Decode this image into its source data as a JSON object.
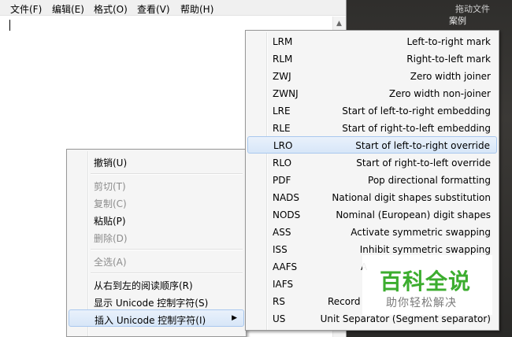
{
  "menubar": {
    "items": [
      "文件(F)",
      "编辑(E)",
      "格式(O)",
      "查看(V)",
      "帮助(H)"
    ]
  },
  "background": {
    "text1": "拖动文件",
    "text2": "案例"
  },
  "context_menu": {
    "items": [
      {
        "label": "撤销(U)",
        "enabled": true
      },
      {
        "label": "剪切(T)",
        "enabled": false
      },
      {
        "label": "复制(C)",
        "enabled": false
      },
      {
        "label": "粘贴(P)",
        "enabled": true
      },
      {
        "label": "删除(D)",
        "enabled": false
      },
      {
        "label": "全选(A)",
        "enabled": false
      },
      {
        "label": "从右到左的阅读顺序(R)",
        "enabled": true
      },
      {
        "label": "显示 Unicode 控制字符(S)",
        "enabled": true
      },
      {
        "label": "插入 Unicode 控制字符(I)",
        "enabled": true,
        "highlighted": true
      }
    ]
  },
  "submenu": {
    "items": [
      {
        "abbr": "LRM",
        "desc": "Left-to-right mark"
      },
      {
        "abbr": "RLM",
        "desc": "Right-to-left mark"
      },
      {
        "abbr": "ZWJ",
        "desc": "Zero width joiner"
      },
      {
        "abbr": "ZWNJ",
        "desc": "Zero width non-joiner"
      },
      {
        "abbr": "LRE",
        "desc": "Start of left-to-right embedding"
      },
      {
        "abbr": "RLE",
        "desc": "Start of right-to-left embedding"
      },
      {
        "abbr": "LRO",
        "desc": "Start of left-to-right override",
        "highlighted": true
      },
      {
        "abbr": "RLO",
        "desc": "Start of right-to-left override"
      },
      {
        "abbr": "PDF",
        "desc": "Pop directional formatting"
      },
      {
        "abbr": "NADS",
        "desc": "National digit shapes substitution"
      },
      {
        "abbr": "NODS",
        "desc": "Nominal (European) digit shapes"
      },
      {
        "abbr": "ASS",
        "desc": "Activate symmetric swapping"
      },
      {
        "abbr": "ISS",
        "desc": "Inhibit symmetric swapping"
      },
      {
        "abbr": "AAFS",
        "desc": "A"
      },
      {
        "abbr": "IAFS",
        "desc": ""
      },
      {
        "abbr": "RS",
        "desc": "Record"
      },
      {
        "abbr": "US",
        "desc": "Unit Separator (Segment separator)"
      }
    ]
  },
  "watermark": {
    "title": "百科全说",
    "subtitle": "助你轻松解决"
  },
  "colors": {
    "watermark_green": "#3cad2f",
    "highlight_border": "#a9c8ee"
  }
}
